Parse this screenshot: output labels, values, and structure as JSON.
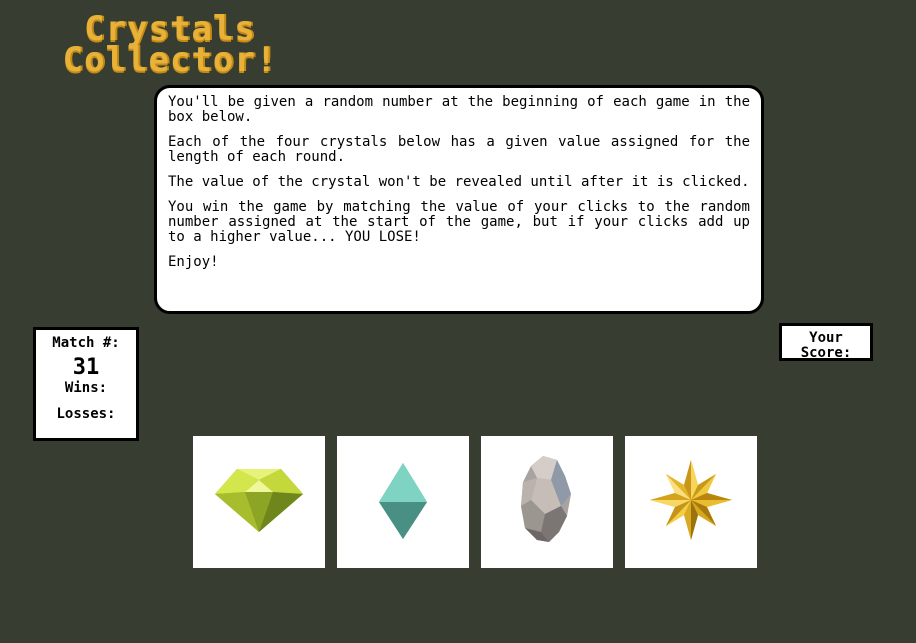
{
  "header": {
    "title_line1": "Crystals",
    "title_line2": "Collector!"
  },
  "instructions": {
    "p1": "You'll be given a random number at the beginning of each game in the box below.",
    "p2": "Each of the four crystals below has a given value assigned for the length of each round.",
    "p3": "The value of the crystal won't be revealed until after it is clicked.",
    "p4": "You win the game by matching the value of your clicks to the random number assigned at the start of the game, but if your clicks add up to a higher value... YOU LOSE!",
    "p5": "Enjoy!"
  },
  "stats": {
    "match_label": "Match #:",
    "target_number": "31",
    "wins_label": "Wins:",
    "losses_label": "Losses:"
  },
  "score": {
    "label": "Your Score:"
  },
  "crystals": [
    {
      "icon": "yellow-green-gem-icon"
    },
    {
      "icon": "teal-diamond-crystal-icon"
    },
    {
      "icon": "gray-rock-crystal-icon"
    },
    {
      "icon": "gold-star-crystal-icon"
    }
  ],
  "colors": {
    "background": "#373d31",
    "title": "#e8b23a",
    "panel": "#ffffff",
    "border": "#000000"
  }
}
